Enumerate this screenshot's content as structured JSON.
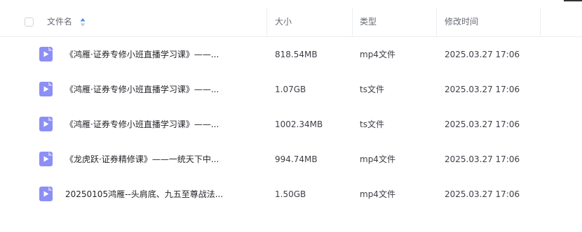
{
  "header": {
    "name": "文件名",
    "size": "大小",
    "type": "类型",
    "modified": "修改时间"
  },
  "icons": {
    "file": "video-file-icon",
    "sort": "sort-icon"
  },
  "colors": {
    "icon": "#8c8ff5",
    "sort_active": "#4a8bf5",
    "sort_inactive": "#c5cad3"
  },
  "files": [
    {
      "name": "《鸿雁·证券专修小班直播学习课》——...",
      "size": "818.54MB",
      "type": "mp4文件",
      "modified": "2025.03.27 17:06"
    },
    {
      "name": "《鸿雁·证券专修小班直播学习课》——...",
      "size": "1.07GB",
      "type": "ts文件",
      "modified": "2025.03.27 17:06"
    },
    {
      "name": "《鸿雁·证券专修小班直播学习课》——...",
      "size": "1002.34MB",
      "type": "ts文件",
      "modified": "2025.03.27 17:06"
    },
    {
      "name": "《龙虎跃·证券精修课》——一统天下中...",
      "size": "994.74MB",
      "type": "mp4文件",
      "modified": "2025.03.27 17:06"
    },
    {
      "name": "20250105鸿雁--头肩底、九五至尊战法...",
      "size": "1.50GB",
      "type": "mp4文件",
      "modified": "2025.03.27 17:06"
    }
  ]
}
